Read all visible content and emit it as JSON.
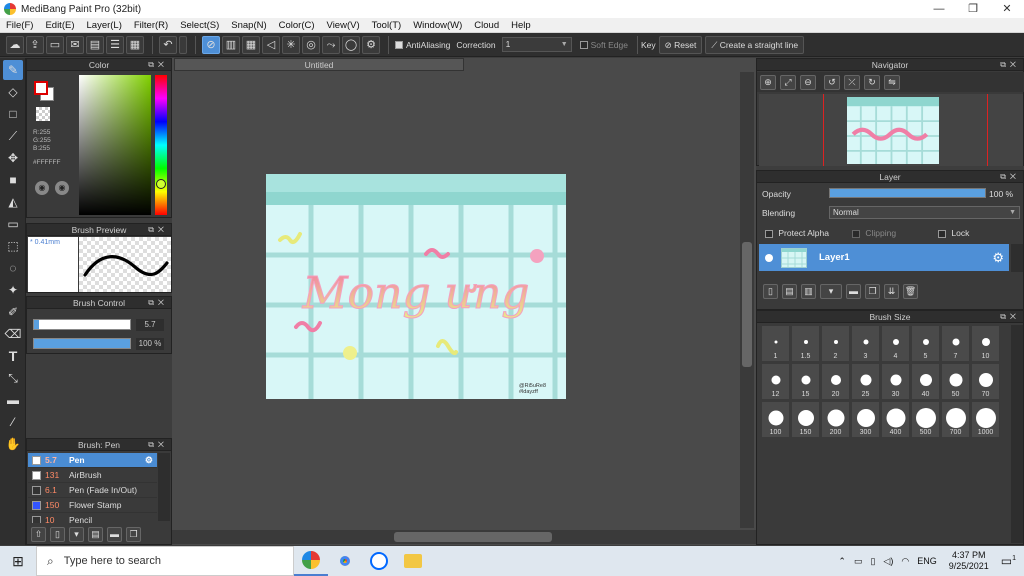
{
  "window": {
    "title": "MediBang Paint Pro (32bit)",
    "buttons": [
      "—",
      "❐",
      "✕"
    ]
  },
  "menu": [
    "File(F)",
    "Edit(E)",
    "Layer(L)",
    "Filter(R)",
    "Select(S)",
    "Snap(N)",
    "Color(C)",
    "View(V)",
    "Tool(T)",
    "Window(W)",
    "Cloud",
    "Help"
  ],
  "toolbar": {
    "antialiasing_label": "AntiAliasing",
    "correction_label": "Correction",
    "correction_value": "1",
    "soft_edge_label": "Soft Edge",
    "key_label": "Key",
    "reset_label": "Reset",
    "straight_line_label": "Create a straight line"
  },
  "color_panel": {
    "title": "Color",
    "r": "R:255",
    "g": "G:255",
    "b": "B:255",
    "hex": "#FFFFFF"
  },
  "brush_preview": {
    "title": "Brush Preview",
    "size": "* 0.41mm"
  },
  "brush_control": {
    "title": "Brush Control",
    "size_value": "5.7",
    "size_fraction": 0.05,
    "opacity_value": "100 %",
    "opacity_fraction": 1.0
  },
  "brush_list": {
    "title": "Brush: Pen",
    "items": [
      {
        "size": "5.7",
        "name": "Pen",
        "color": "#ffffff",
        "active": true
      },
      {
        "size": "131",
        "name": "AirBrush",
        "color": "#ffffff",
        "active": false
      },
      {
        "size": "6.1",
        "name": "Pen (Fade In/Out)",
        "color": "#333333",
        "active": false
      },
      {
        "size": "150",
        "name": "Flower Stamp",
        "color": "#3355ff",
        "active": false
      },
      {
        "size": "10",
        "name": "Pencil",
        "color": "#333333",
        "active": false
      }
    ]
  },
  "canvas": {
    "tab_title": "Untitled",
    "artwork_text": "Mong ưng",
    "watermark_line1": "@Ri5uRe8",
    "watermark_line2": "#ldayzff"
  },
  "navigator": {
    "title": "Navigator"
  },
  "layer_panel": {
    "title": "Layer",
    "opacity_label": "Opacity",
    "opacity_value": "100 %",
    "opacity_fraction": 1.0,
    "blending_label": "Blending",
    "blending_value": "Normal",
    "protect_alpha_label": "Protect Alpha",
    "clipping_label": "Clipping",
    "lock_label": "Lock",
    "layer_name": "Layer1"
  },
  "brush_size_panel": {
    "title": "Brush Size",
    "sizes": [
      "1",
      "1.5",
      "2",
      "3",
      "4",
      "5",
      "7",
      "10",
      "12",
      "15",
      "20",
      "25",
      "30",
      "40",
      "50",
      "70",
      "100",
      "150",
      "200",
      "300",
      "400",
      "500",
      "700",
      "1000"
    ]
  },
  "taskbar": {
    "search_placeholder": "Type here to search",
    "time": "4:37 PM",
    "date": "9/25/2021",
    "language": "ENG",
    "notification_count": "1"
  },
  "colors": {
    "accent": "#4e8fd6",
    "canvas_bg": "#d8f7f7",
    "grid": "#a6dcd8",
    "header_band": "#9fded8",
    "text_gradient_pink": "#f27aa6",
    "text_gradient_yellow": "#e9ee88"
  }
}
